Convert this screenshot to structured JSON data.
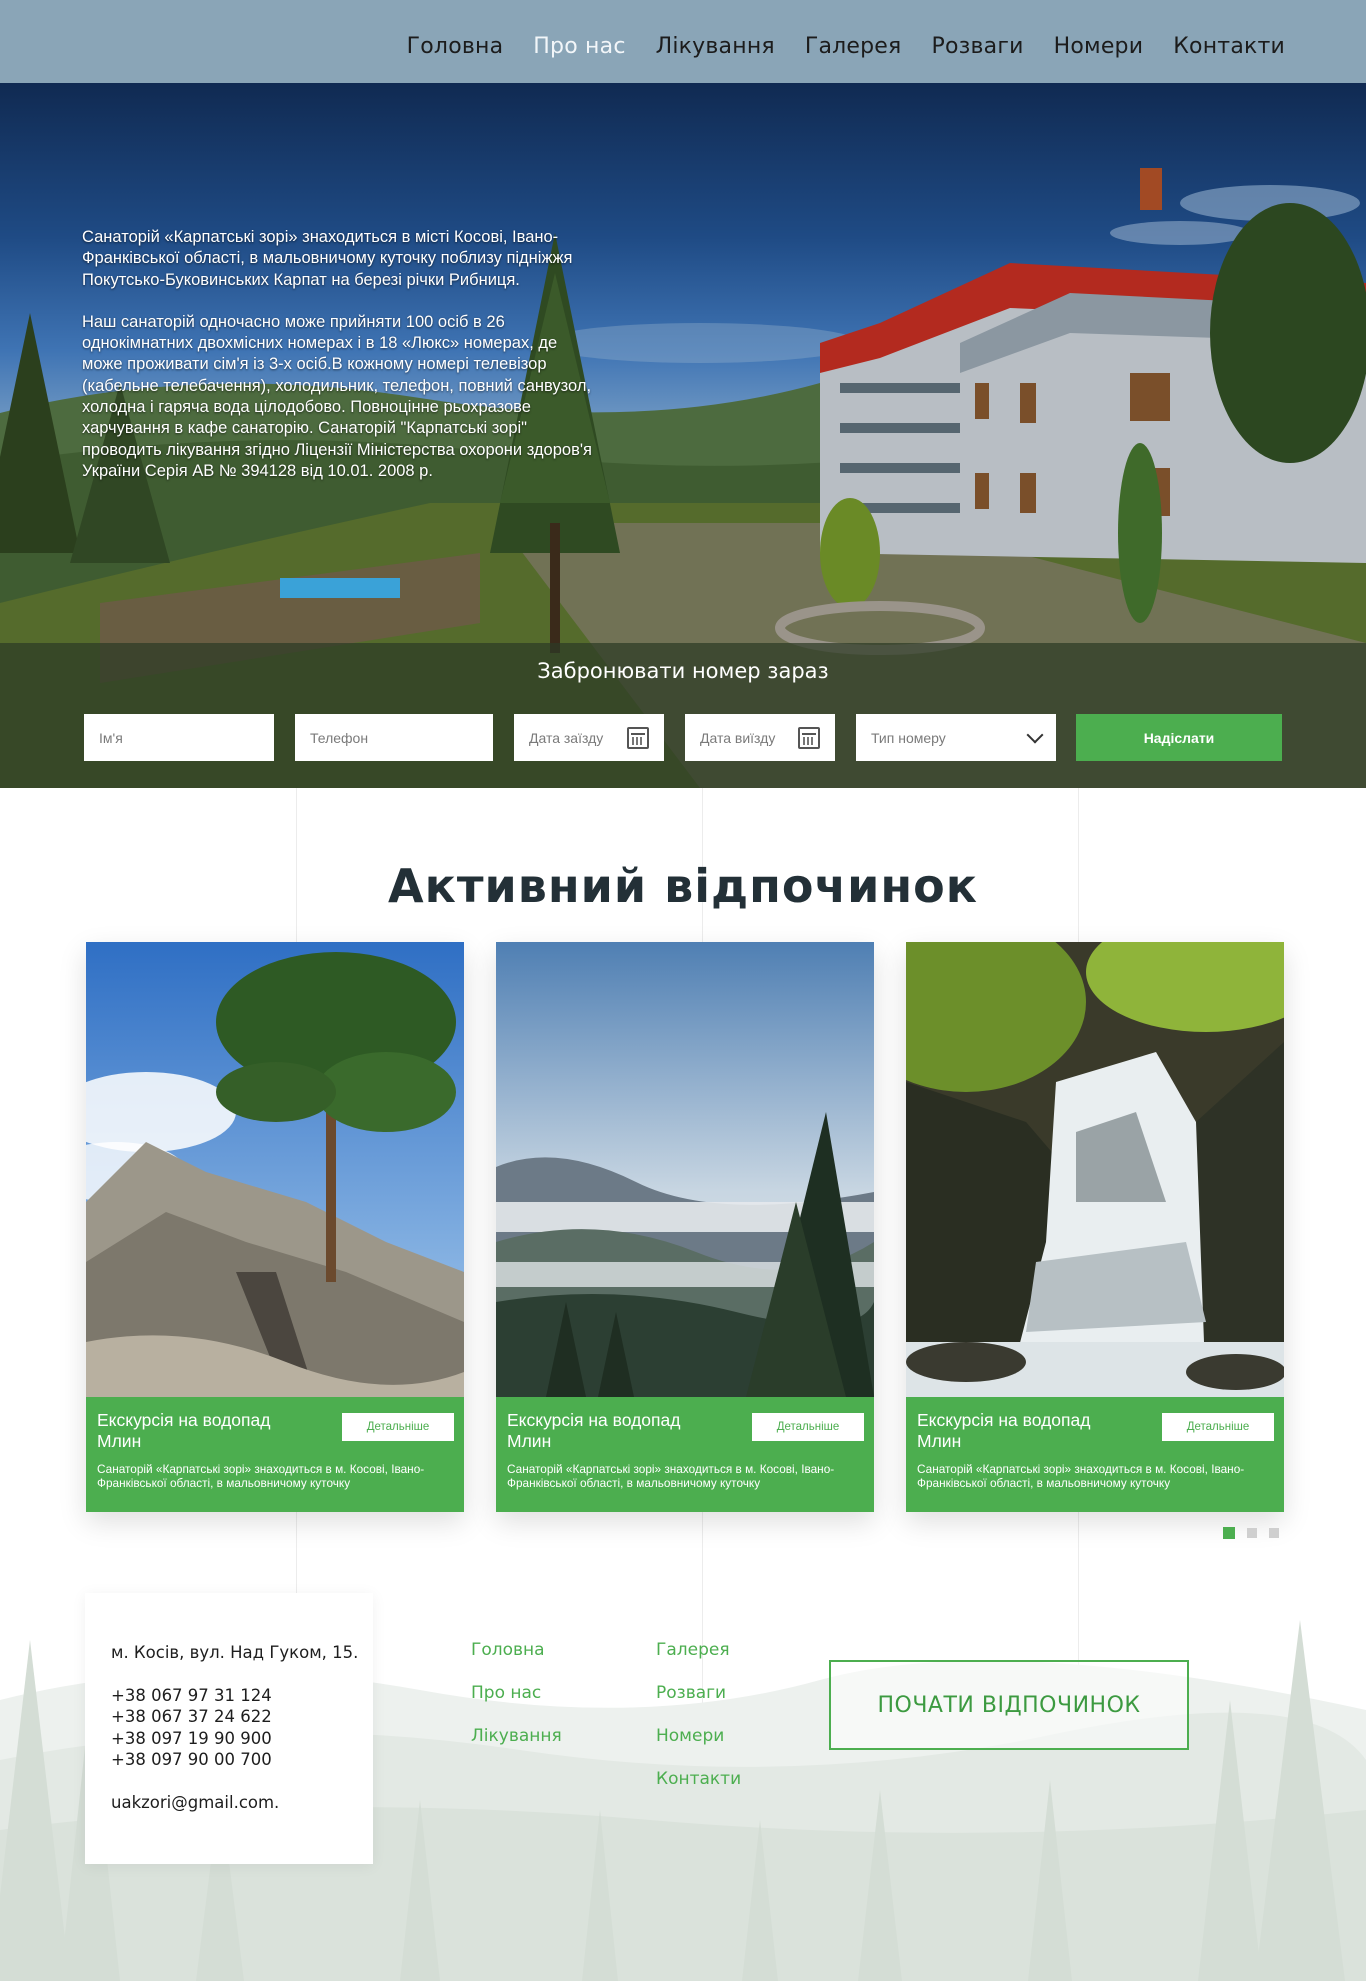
{
  "nav": {
    "items": [
      "Головна",
      "Про нас",
      "Лікування",
      "Галерея",
      "Розваги",
      "Номери",
      "Контакти"
    ],
    "active_index": 1
  },
  "hero": {
    "paragraph1": "Санаторій «Карпатські зорі» знаходиться в місті Косові, Івано-Франківської області, в мальовничому куточку поблизу підніжжя Покутсько-Буковинських Карпат на березі річки Рибниця.",
    "paragraph2": "Наш санаторій одночасно може прийняти 100 осіб в 26 однокімнатних двохмісних номерах і в 18 «Люкс» номерах, де може проживати сім'я із 3-х осіб.В кожному номері телевізор (кабельне телебачення), холодильник, телефон, повний санвузол, холодна і гаряча вода цілодобово. Повноцінне рьохразове харчування в кафе санаторію. Санаторій \"Карпатські зорі\" проводить лікування згідно Ліцензії Міністерства охорони здоров'я України Серія АВ № 394128 від 10.01. 2008 р."
  },
  "booking": {
    "title": "Забронювати номер зараз",
    "name_placeholder": "Ім'я",
    "phone_placeholder": "Телефон",
    "checkin_placeholder": "Дата заїзду",
    "checkout_placeholder": "Дата виїзду",
    "room_type_placeholder": "Тип номеру",
    "submit_label": "Надіслати",
    "icons": [
      "calendar-icon",
      "calendar-icon",
      "chevron-down-icon"
    ]
  },
  "section": {
    "title": "Активний відпочинок",
    "cards": [
      {
        "title": "Екскурсія на водопад Млин",
        "button": "Детальніше",
        "description": "Санаторій «Карпатські зорі» знаходиться в м. Косові, Івано-Франківської області, в мальовничому куточку"
      },
      {
        "title": "Екскурсія на водопад Млин",
        "button": "Детальніше",
        "description": "Санаторій «Карпатські зорі» знаходиться в м. Косові, Івано-Франківської області, в мальовничому куточку"
      },
      {
        "title": "Екскурсія на водопад Млин",
        "button": "Детальніше",
        "description": "Санаторій «Карпатські зорі» знаходиться в м. Косові, Івано-Франківської області, в мальовничому куточку"
      }
    ],
    "slider_dots": 3,
    "active_dot": 0
  },
  "footer": {
    "address": "м. Косів, вул. Над Гуком, 15.",
    "phones": [
      "+38 067 97 31 124",
      "+38 067 37 24 622",
      "+38 097 19 90 900",
      "+38 097 90 00 700"
    ],
    "email": "uakzori@gmail.com.",
    "links_col1": [
      "Головна",
      "Про нас",
      "Лікування"
    ],
    "links_col2": [
      "Галерея",
      "Розваги",
      "Номери",
      "Контакти"
    ],
    "cta_label": "ПОЧАТИ ВІДПОЧИНОК"
  },
  "colors": {
    "header_bg": "#8aa5b7",
    "accent_green": "#4cae4f",
    "title_dark": "#233037"
  }
}
